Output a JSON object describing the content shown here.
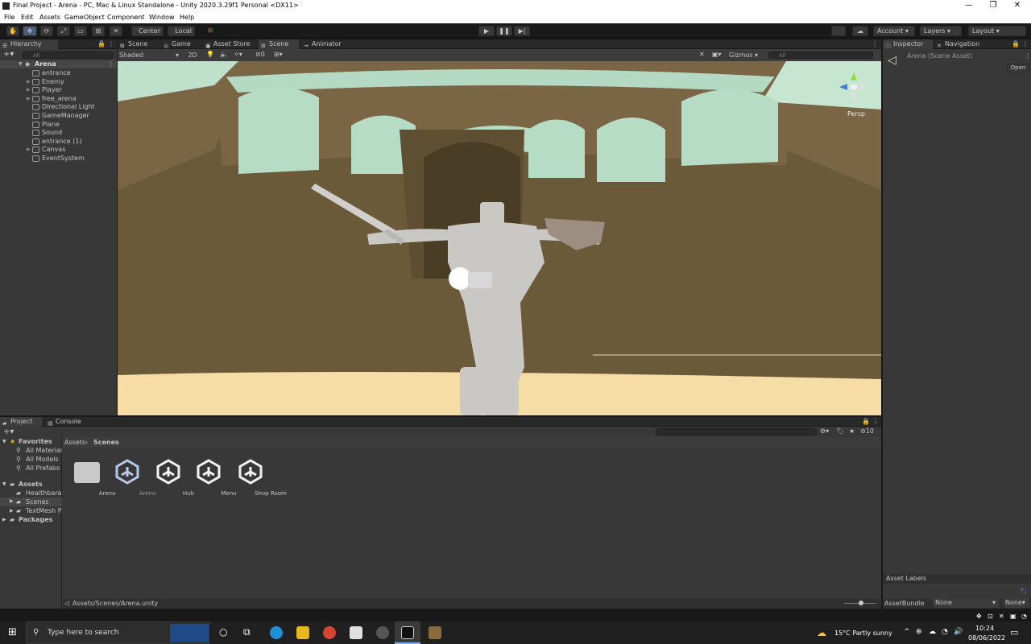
{
  "window": {
    "title": "Final Project - Arena - PC, Mac & Linux Standalone - Unity 2020.3.29f1 Personal <DX11>",
    "controls": [
      "—",
      "❐",
      "✕"
    ]
  },
  "menu": [
    "File",
    "Edit",
    "Assets",
    "GameObject",
    "Component",
    "Window",
    "Help"
  ],
  "toolbar": {
    "pivot_label": "Center",
    "space_label": "Local",
    "account_label": "Account",
    "layers_label": "Layers",
    "layout_label": "Layout"
  },
  "hierarchy": {
    "tab_label": "Hierarchy",
    "search_placeholder": "All",
    "scene_name": "Arena",
    "items": [
      {
        "label": "entrance",
        "expandable": false
      },
      {
        "label": "Enemy",
        "expandable": true
      },
      {
        "label": "Player",
        "expandable": true
      },
      {
        "label": "free_arena",
        "expandable": true
      },
      {
        "label": "Directional Light",
        "expandable": false
      },
      {
        "label": "GameManager",
        "expandable": false
      },
      {
        "label": "Plane",
        "expandable": false
      },
      {
        "label": "Sound",
        "expandable": false
      },
      {
        "label": "entrance (1)",
        "expandable": false
      },
      {
        "label": "Canvas",
        "expandable": true
      },
      {
        "label": "EventSystem",
        "expandable": false
      }
    ]
  },
  "center_tabs": [
    "Scene",
    "Game",
    "Asset Store",
    "Scene",
    "Animator"
  ],
  "scene_toolbar": {
    "shading_mode": "Shaded",
    "mode_2d": "2D",
    "hidden_count": "0",
    "gizmos_label": "Gizmos",
    "search_placeholder": "All",
    "view_label": "Persp"
  },
  "inspector": {
    "tabs": [
      "Inspector",
      "Navigation"
    ],
    "asset_title": "Arena (Scene Asset)",
    "open_button": "Open",
    "asset_labels": "Asset Labels",
    "asset_bundle_label": "AssetBundle",
    "asset_bundle_value": "None",
    "variant_value": "None"
  },
  "project": {
    "tabs": [
      "Project",
      "Console"
    ],
    "favorites_label": "Favorites",
    "favorites": [
      "All Materials",
      "All Models",
      "All Prefabs"
    ],
    "assets_label": "Assets",
    "assets_folders": [
      "Healthbaras",
      "Scenes",
      "TextMesh P"
    ],
    "packages_label": "Packages",
    "breadcrumb": [
      "Assets",
      "Scenes"
    ],
    "hidden_count": "10",
    "items": [
      {
        "label": "Arena",
        "kind": "folder"
      },
      {
        "label": "Arena",
        "kind": "unity"
      },
      {
        "label": "Hub",
        "kind": "unity"
      },
      {
        "label": "Menu",
        "kind": "unity"
      },
      {
        "label": "Shop Room",
        "kind": "unity"
      }
    ],
    "path": "Assets/Scenes/Arena.unity"
  },
  "taskbar": {
    "search_placeholder": "Type here to search",
    "weather": "15°C  Partly sunny",
    "time": "10:24",
    "date": "08/06/2022"
  },
  "colors": {
    "accent": "#4a5d7a",
    "panel": "#383838",
    "header": "#282828",
    "sky": "#b9dcc6",
    "wall": "#6b5a3a",
    "floor": "#f3d7a0"
  }
}
